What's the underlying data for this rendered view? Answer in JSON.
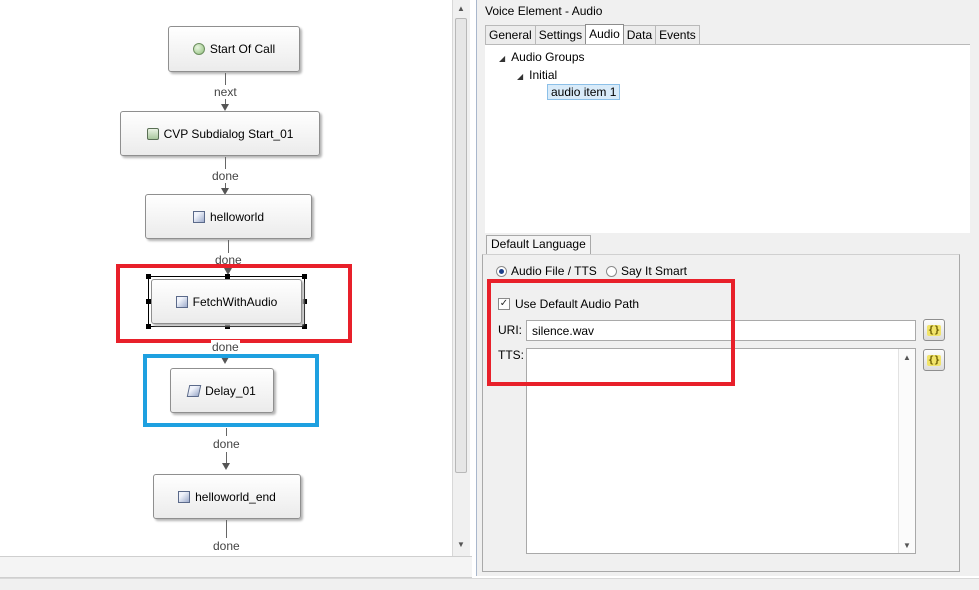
{
  "flow": {
    "nodes": {
      "start_of_call": "Start Of Call",
      "cvp_subdialog_start": "CVP Subdialog Start_01",
      "helloworld": "helloworld",
      "fetch_with_audio": "FetchWithAudio",
      "delay": "Delay_01",
      "helloworld_end": "helloworld_end"
    },
    "edges": {
      "next": "next",
      "done": "done"
    },
    "highlight_colors": {
      "red": "#e8202a",
      "blue": "#1ea0e0"
    }
  },
  "panel": {
    "title": "Voice Element - Audio",
    "tabs": [
      "General",
      "Settings",
      "Audio",
      "Data",
      "Events"
    ],
    "active_tab": "Audio",
    "tree": {
      "root": "Audio Groups",
      "group": "Initial",
      "item": "audio item 1"
    },
    "language_tab": "Default Language",
    "radio_audio_file": "Audio File / TTS",
    "radio_say_it_smart": "Say It Smart",
    "use_default_audio_path": "Use Default Audio Path",
    "uri_label": "URI:",
    "uri_value": "silence.wav",
    "tts_label": "TTS:",
    "expression_button": "{}"
  }
}
